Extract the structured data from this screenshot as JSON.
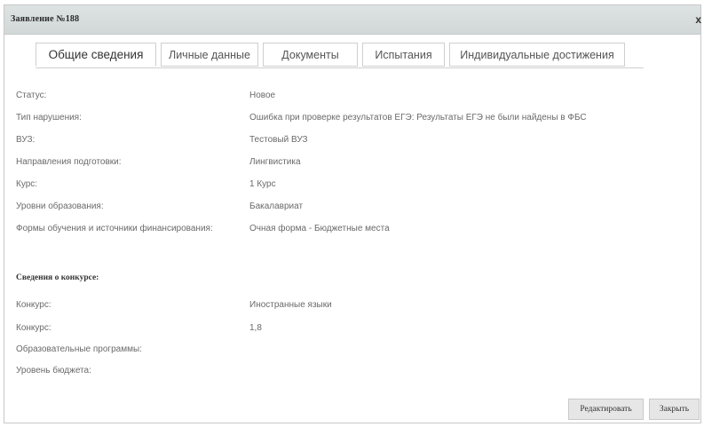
{
  "dialog": {
    "title": "Заявление №188",
    "close_glyph": "x"
  },
  "tabs": [
    {
      "label": "Общие сведения",
      "active": true
    },
    {
      "label": "Личные данные",
      "active": false
    },
    {
      "label": "Документы",
      "active": false
    },
    {
      "label": "Испытания",
      "active": false
    },
    {
      "label": "Индивидуальные достижения",
      "active": false
    }
  ],
  "general": {
    "status": {
      "label": "Статус:",
      "value": "Новое"
    },
    "violation": {
      "label": "Тип нарушения:",
      "value": "Ошибка при проверке результатов ЕГЭ: Результаты ЕГЭ не были найдены в ФБС"
    },
    "university": {
      "label": "ВУЗ:",
      "value": "Тестовый ВУЗ"
    },
    "directions": {
      "label": "Направления подготовки:",
      "value": "Лингвистика"
    },
    "course": {
      "label": "Курс:",
      "value": "1 Курс"
    },
    "levels": {
      "label": "Уровни образования:",
      "value": "Бакалавриат"
    },
    "forms": {
      "label": "Формы обучения и источники финансирования:",
      "value": "Очная форма - Бюджетные места"
    }
  },
  "competition": {
    "heading": "Сведения о конкурсе:",
    "contest": {
      "label": "Конкурс:",
      "value": "Иностранные языки"
    },
    "contest_ratio": {
      "label": "Конкурс:",
      "value": "1,8"
    },
    "programs": {
      "label": "Образовательные программы:",
      "value": ""
    },
    "budget_level": {
      "label": "Уровень бюджета:",
      "value": ""
    }
  },
  "buttons": {
    "edit": "Редактировать",
    "close": "Закрыть"
  }
}
